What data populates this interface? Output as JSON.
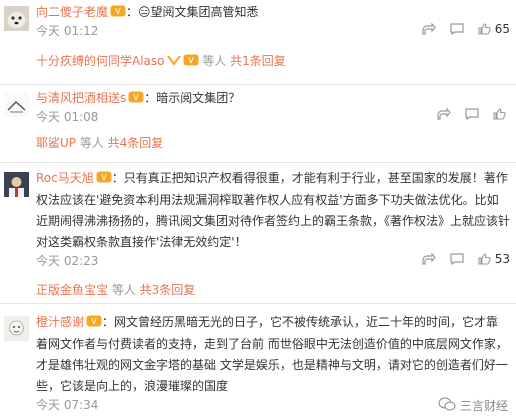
{
  "comments": [
    {
      "user": "向二傻子老魔",
      "text": "：😑望阅文集团高管知悉",
      "time": "今天 01:12",
      "likes": "65",
      "reply_summary": {
        "names": "十分疚缚的何同学Alaso",
        "suffix": " 等人 ",
        "count": "共1条回复"
      }
    },
    {
      "user": "与清风把酒相送s",
      "text": "：暗示阅文集团？",
      "time": "今天 01:08",
      "likes": "",
      "reply_summary": {
        "names": "耶鲨UP",
        "suffix": " 等人 ",
        "count": "共4条回复"
      }
    },
    {
      "user": "Roc马天旭",
      "text": "：只有真正把知识产权看得很重，才能有利于行业，甚至国家的发展！著作权法应该在'避免资本利用法规漏洞榨取著作权人应有权益'方面多下功夫做法优化。比如近期闹得沸沸扬扬的，腾讯阅文集团对待作者签约上的霸王条款，《著作权法》上就应该针对这类霸权条款直接作'法律无效约定'！",
      "time": "今天 02:23",
      "likes": "53",
      "reply_summary": {
        "names": "正版金鱼宝宝",
        "suffix": " 等人 ",
        "count": "共3条回复"
      }
    },
    {
      "user": "橙汁感谢",
      "text": "：网文曾经历黑暗无光的日子，它不被传统承认，近二十年的时间，它才靠着网文作者与付费读者的支持，走到了台前 而世俗眼中无法创造价值的中底层网文作家，才是雄伟壮观的网文金字塔的基础 文学是娱乐，也是精神与文明，请对它的创造者们好一些，它该是向上的，浪漫璀璨的国度",
      "time": "今天 07:34",
      "likes": "",
      "reply_summary": null
    }
  ],
  "icons": {
    "share": "share-icon",
    "comment": "comment-icon",
    "like": "thumb-up-icon",
    "vip": "vip-badge-icon"
  },
  "watermark": "三言财经",
  "colors": {
    "username": "#eb7350",
    "meta": "#999999",
    "vip": "#f5a623"
  }
}
